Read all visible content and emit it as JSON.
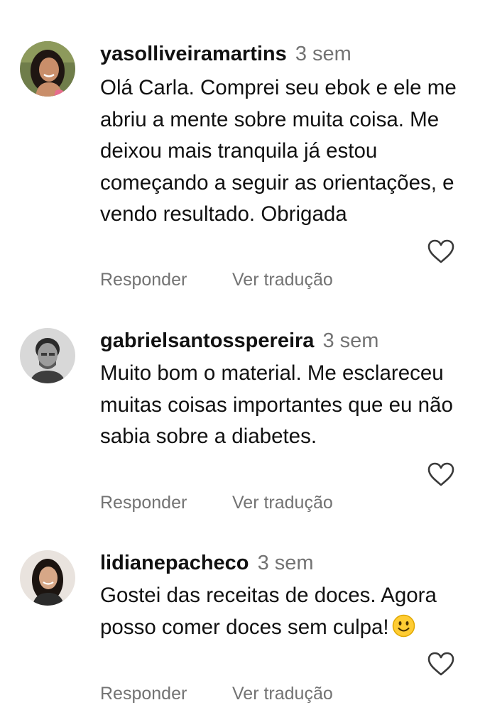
{
  "comments": [
    {
      "username": "yasolliveiramartins",
      "time": "3 sem",
      "text": "Olá Carla. Comprei seu ebok e ele me abriu a mente sobre muita coisa. Me deixou mais tranquila já estou começando a seguir as orientações, e vendo resultado. Obrigada",
      "reply_label": "Responder",
      "translate_label": "Ver tradução"
    },
    {
      "username": "gabrielsantosspereira",
      "time": "3 sem",
      "text": "Muito bom o material. Me esclareceu muitas coisas importantes que eu não sabia sobre a diabetes.",
      "reply_label": "Responder",
      "translate_label": "Ver tradução"
    },
    {
      "username": "lidianepacheco",
      "time": "3 sem",
      "text": "Gostei das receitas de doces. Agora posso comer doces sem culpa!",
      "emoji": "slightly-smiling-face-emoji",
      "reply_label": "Responder",
      "translate_label": "Ver tradução"
    }
  ],
  "icons": {
    "like": "heart-outline-icon"
  },
  "colors": {
    "text": "#111111",
    "secondary": "#737373",
    "background": "#ffffff"
  }
}
